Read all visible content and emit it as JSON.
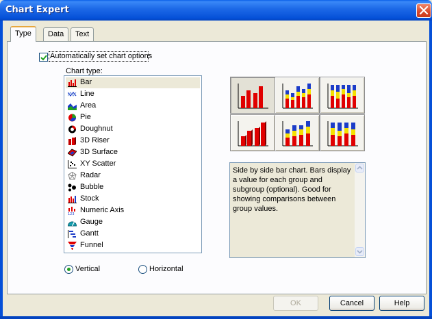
{
  "window": {
    "title": "Chart Expert"
  },
  "tabs": [
    {
      "label": "Type",
      "active": true
    },
    {
      "label": "Data",
      "active": false
    },
    {
      "label": "Text",
      "active": false
    }
  ],
  "auto_option": {
    "label": "Automatically set chart options",
    "checked": true
  },
  "chart_type_label": "Chart type:",
  "chart_types": [
    {
      "label": "Bar",
      "icon": "bar-chart-icon",
      "selected": true
    },
    {
      "label": "Line",
      "icon": "line-chart-icon"
    },
    {
      "label": "Area",
      "icon": "area-chart-icon"
    },
    {
      "label": "Pie",
      "icon": "pie-chart-icon"
    },
    {
      "label": "Doughnut",
      "icon": "doughnut-chart-icon"
    },
    {
      "label": "3D Riser",
      "icon": "3d-riser-icon"
    },
    {
      "label": "3D Surface",
      "icon": "3d-surface-icon"
    },
    {
      "label": "XY Scatter",
      "icon": "xy-scatter-icon"
    },
    {
      "label": "Radar",
      "icon": "radar-chart-icon"
    },
    {
      "label": "Bubble",
      "icon": "bubble-chart-icon"
    },
    {
      "label": "Stock",
      "icon": "stock-chart-icon"
    },
    {
      "label": "Numeric Axis",
      "icon": "numeric-axis-icon"
    },
    {
      "label": "Gauge",
      "icon": "gauge-icon"
    },
    {
      "label": "Gantt",
      "icon": "gantt-chart-icon"
    },
    {
      "label": "Funnel",
      "icon": "funnel-chart-icon"
    }
  ],
  "orientation": {
    "vertical_label": "Vertical",
    "horizontal_label": "Horizontal",
    "selected": "Vertical"
  },
  "subtypes": [
    {
      "name": "side-by-side-bar",
      "pressed": true
    },
    {
      "name": "stacked-bar",
      "pressed": false
    },
    {
      "name": "percent-stacked-bar",
      "pressed": false
    },
    {
      "name": "3d-side-by-side-bar",
      "pressed": false
    },
    {
      "name": "3d-stacked-bar",
      "pressed": false
    },
    {
      "name": "3d-percent-stacked-bar",
      "pressed": false
    }
  ],
  "description": "Side by side bar chart. Bars display a value for each group and subgroup (optional). Good for showing comparisons between group values.",
  "buttons": {
    "ok": "OK",
    "cancel": "Cancel",
    "help": "Help"
  },
  "colors": {
    "titlebar": "#0550D8",
    "face": "#ECE9D8",
    "bar_red": "#E00000",
    "bar_yellow": "#F5E000",
    "bar_blue": "#1C3CC8"
  }
}
